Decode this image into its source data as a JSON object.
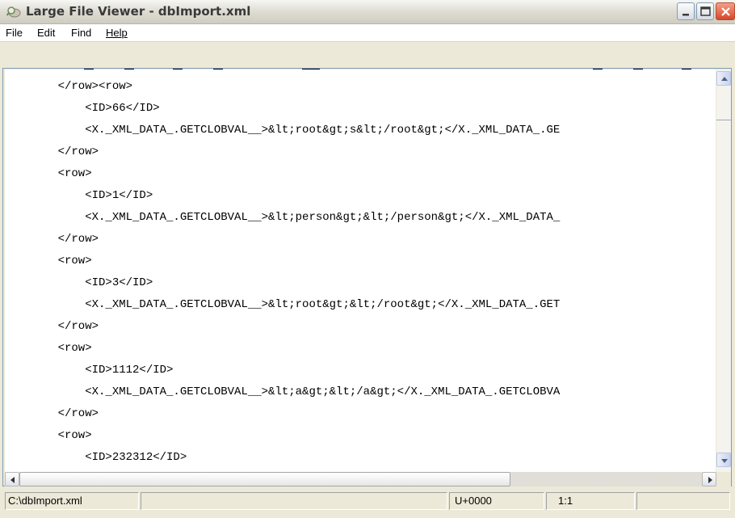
{
  "window": {
    "title": "Large File Viewer - dbImport.xml",
    "icon": "app-magnifier-icon"
  },
  "title_buttons": {
    "minimize": "minimize-icon",
    "maximize": "maximize-icon",
    "close": "close-icon"
  },
  "menu": {
    "items": [
      "File",
      "Edit",
      "Find",
      "Help"
    ]
  },
  "editor": {
    "lines": [
      "    </row><row>",
      "        <ID>66</ID>",
      "        <X._XML_DATA_.GETCLOBVAL__>&lt;root&gt;s&lt;/root&gt;</X._XML_DATA_.GE",
      "    </row>",
      "    <row>",
      "        <ID>1</ID>",
      "        <X._XML_DATA_.GETCLOBVAL__>&lt;person&gt;&lt;/person&gt;</X._XML_DATA_",
      "    </row>",
      "    <row>",
      "        <ID>3</ID>",
      "        <X._XML_DATA_.GETCLOBVAL__>&lt;root&gt;&lt;/root&gt;</X._XML_DATA_.GET",
      "    </row>",
      "    <row>",
      "        <ID>1112</ID>",
      "        <X._XML_DATA_.GETCLOBVAL__>&lt;a&gt;&lt;/a&gt;</X._XML_DATA_.GETCLOBVA",
      "    </row>",
      "    <row>",
      "        <ID>232312</ID>"
    ]
  },
  "scrollbars": {
    "up_arrow": "arrow-up-icon",
    "down_arrow": "arrow-down-icon",
    "left_arrow": "arrow-left-icon",
    "right_arrow": "arrow-right-icon"
  },
  "status": {
    "file_path": "C:\\dbImport.xml",
    "message": "",
    "codepoint": "U+0000",
    "position": "1:1",
    "extra": ""
  },
  "colors": {
    "border": "#7f9db9",
    "chrome": "#ece9d8",
    "close_button": "#d8462a"
  }
}
